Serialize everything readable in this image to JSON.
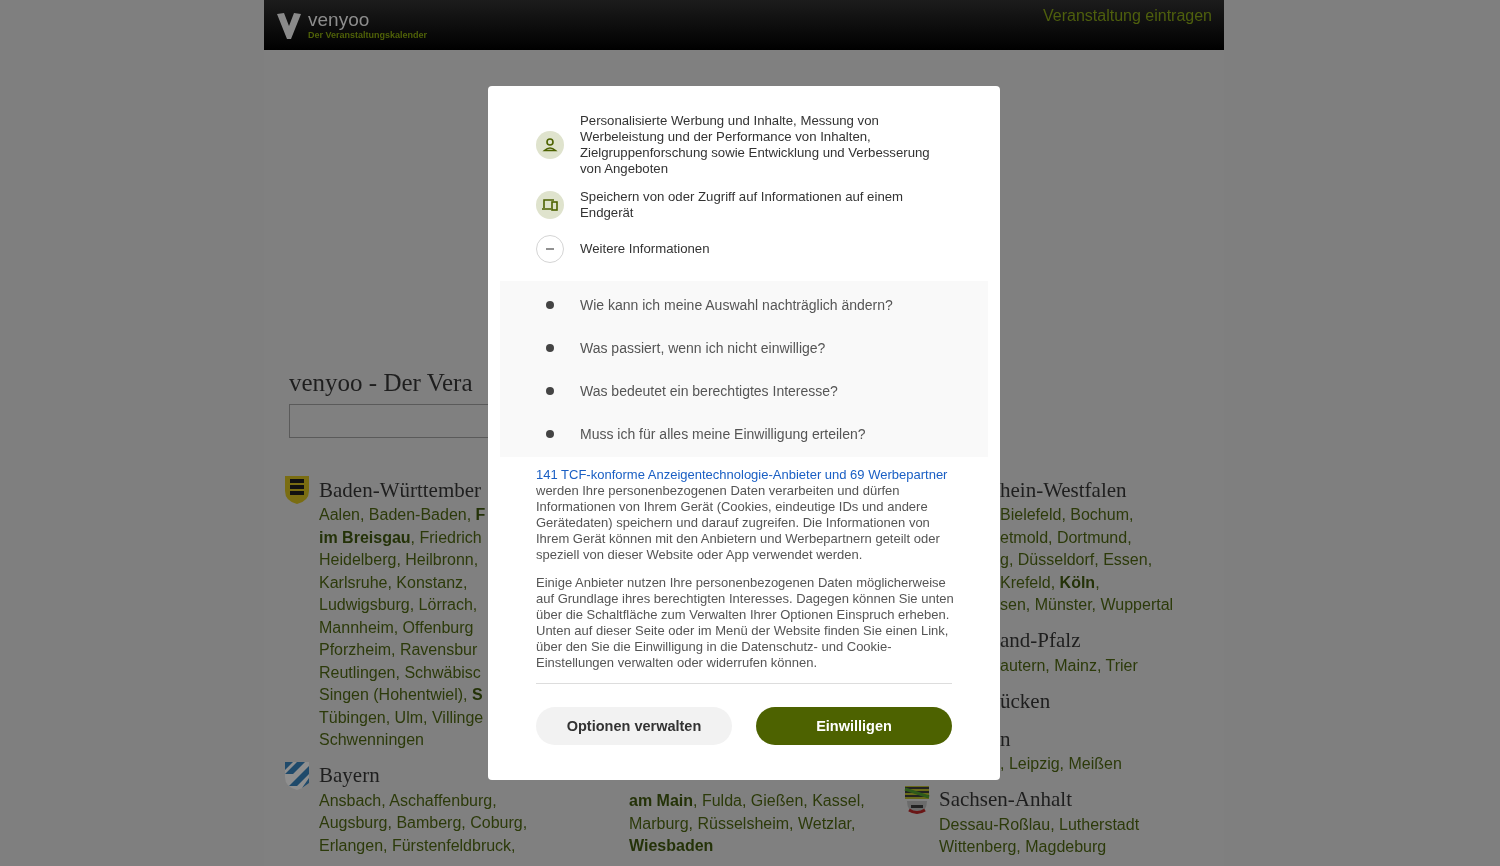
{
  "header": {
    "logo_name": "venyoo",
    "logo_tagline": "Der Veranstaltungskalender",
    "action_link": "Veranstaltung eintragen"
  },
  "page": {
    "heading": "venyoo - Der Vera"
  },
  "columns": [
    {
      "states": [
        {
          "name": "Baden-Württember",
          "cities": [
            "Aalen, Baden-Baden, **F**",
            "**im Breisgau**, Friedrich",
            "Heidelberg, Heilbronn,",
            "Karlsruhe, Konstanz,",
            "Ludwigsburg, Lörrach,",
            "Mannheim, Offenburg",
            "Pforzheim, Ravensbur",
            "Reutlingen, Schwäbisc",
            "Singen (Hohentwiel), **S**",
            "Tübingen, Ulm, Villinge",
            "Schwenningen"
          ]
        },
        {
          "name": "Bayern",
          "cities": [
            "Ansbach, Aschaffenburg,",
            "Augsburg, Bamberg, Coburg,",
            "Erlangen, Fürstenfeldbruck,"
          ]
        }
      ]
    },
    {
      "states": [
        {
          "cities": [
            "**am Main**, Fulda, Gießen, Kassel,",
            "Marburg, Rüsselsheim, Wetzlar,",
            "**Wiesbaden**"
          ]
        }
      ]
    },
    {
      "states": [
        {
          "name": "hein-Westfalen",
          "cities": [
            "Bielefeld, Bochum,",
            "etmold, Dortmund,",
            "g, Düsseldorf, Essen,",
            "Krefeld, **Köln**,",
            "sen, Münster, Wuppertal"
          ]
        },
        {
          "name": "and-Pfalz",
          "cities": [
            "autern, Mainz, Trier"
          ]
        },
        {
          "name": "ücken"
        },
        {
          "name": "n",
          "cities": [
            ", Leipzig, Meißen"
          ]
        },
        {
          "name": "Sachsen-Anhalt",
          "cities": [
            "Dessau-Roßlau, Lutherstadt",
            "Wittenberg, Magdeburg"
          ]
        }
      ]
    }
  ],
  "consent": {
    "purposes": [
      {
        "text": "Personalisierte Werbung und Inhalte, Messung von Werbeleistung und der Performance von Inhalten, Zielgruppenforschung sowie Entwicklung und Verbesserung von Angeboten"
      },
      {
        "text": "Speichern von oder Zugriff auf Informationen auf einem Endgerät"
      }
    ],
    "more_info": {
      "label": "Weitere Informationen",
      "expanded": true
    },
    "faq": [
      "Wie kann ich meine Auswahl nachträglich ändern?",
      "Was passiert, wenn ich nicht einwillige?",
      "Was bedeutet ein berechtigtes Interesse?",
      "Muss ich für alles meine Einwilligung erteilen?"
    ],
    "vendor_link": "141 TCF-konforme Anzeigentechnologie-Anbieter und 69 Werbepartner",
    "paragraph_1": "werden Ihre personenbezogenen Daten verarbeiten und dürfen Informationen von Ihrem Gerät (Cookies, eindeutige IDs und andere Gerätedaten) speichern und darauf zugreifen. Die Informationen von Ihrem Gerät können mit den Anbietern und Werbepartnern geteilt oder speziell von dieser Website oder App verwendet werden.",
    "paragraph_2": "Einige Anbieter nutzen Ihre personenbezogenen Daten möglicherweise auf Grundlage ihres berechtigten Interesses. Dagegen können Sie unten über die Schaltfläche zum Verwalten Ihrer Optionen Einspruch erheben. Unten auf dieser Seite oder im Menü der Website finden Sie einen Link, über den Sie die Einwilligung in die Datenschutz- und Cookie-Einstellungen verwalten oder widerrufen können.",
    "buttons": [
      {
        "label": "Optionen verwalten",
        "kind": "secondary"
      },
      {
        "label": "Einwilligen",
        "kind": "primary"
      }
    ]
  }
}
